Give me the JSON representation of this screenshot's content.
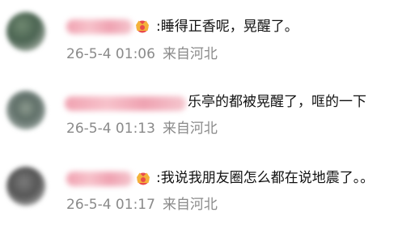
{
  "comments": [
    {
      "text": ":睡得正香呢，晃醒了。",
      "time": "26-5-4 01:06",
      "location": "来自河北"
    },
    {
      "text": "乐亭的都被晃醒了，哐的一下",
      "time": "26-5-4 01:13",
      "location": "来自河北"
    },
    {
      "text": ":我说我朋友圈怎么都在说地震了。。",
      "time": "26-5-4 01:17",
      "location": "来自河北"
    }
  ],
  "icons": {
    "badge": "crown-badge-icon"
  },
  "colors": {
    "text": "#111111",
    "meta": "#8a8a8a",
    "badge_gold": "#f4b23a",
    "badge_red": "#e94b4b",
    "blurred_name": "#f0a2b1"
  }
}
